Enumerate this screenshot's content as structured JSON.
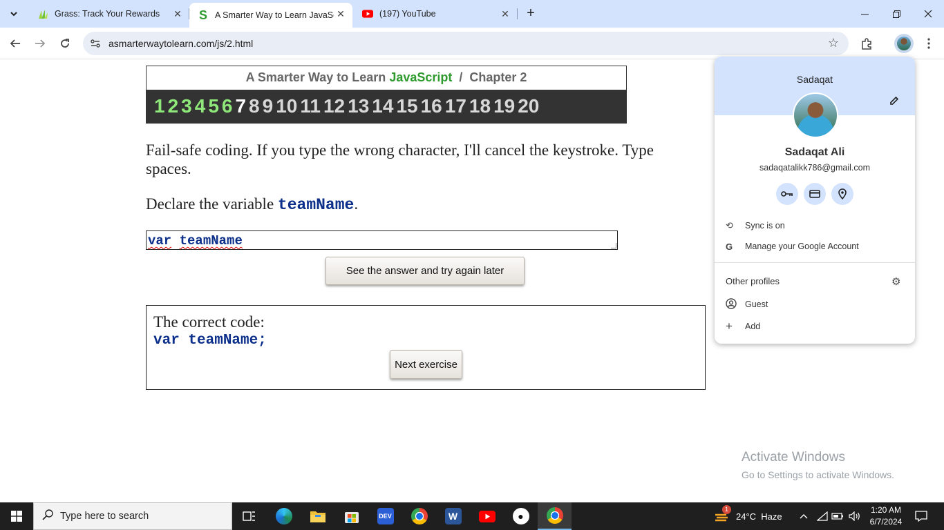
{
  "browser": {
    "tabs": [
      {
        "title": "Grass: Track Your Rewards",
        "active": false
      },
      {
        "title": "A Smarter Way to Learn JavaSc",
        "active": true
      },
      {
        "title": "(197) YouTube",
        "active": false
      }
    ],
    "url": "asmarterwaytolearn.com/js/2.html"
  },
  "chapter": {
    "title_prefix": "A Smarter Way to Learn ",
    "title_js": "JavaScript",
    "title_suffix": "  /  Chapter 2",
    "numbers": [
      "1",
      "2",
      "3",
      "4",
      "5",
      "6",
      "7",
      "8",
      "9",
      "10",
      "11",
      "12",
      "13",
      "14",
      "15",
      "16",
      "17",
      "18",
      "19",
      "20"
    ],
    "done_count": 6,
    "current": "7"
  },
  "exercise": {
    "intro": "Fail-safe coding. If you type the wrong character, I'll cancel the keystroke. Type spaces.",
    "instruction_prefix": "Declare the variable ",
    "instruction_code": "teamName",
    "instruction_suffix": ".",
    "input_word1": "var",
    "input_word2": "teamName",
    "see_answer_label": "See the answer and try again later",
    "correct_label": "The correct code:",
    "correct_code": "var teamName;",
    "next_label": "Next exercise"
  },
  "profile": {
    "header_name": "Sadaqat",
    "full_name": "Sadaqat Ali",
    "email": "sadaqatalikk786@gmail.com",
    "sync": "Sync is on",
    "manage": "Manage your Google Account",
    "other_profiles": "Other profiles",
    "guest": "Guest",
    "add": "Add"
  },
  "watermark": {
    "line1": "Activate Windows",
    "line2": "Go to Settings to activate Windows."
  },
  "taskbar": {
    "search_placeholder": "Type here to search",
    "weather": "24°C  Haze",
    "time": "1:20 AM",
    "date": "6/7/2024",
    "weather_badge": "1"
  },
  "colors": {
    "done_chapter": "#8fe87a",
    "javascript_green": "#2f9b2f",
    "code_blue": "#0b2f8a",
    "tab_bar": "#d3e3fd"
  }
}
